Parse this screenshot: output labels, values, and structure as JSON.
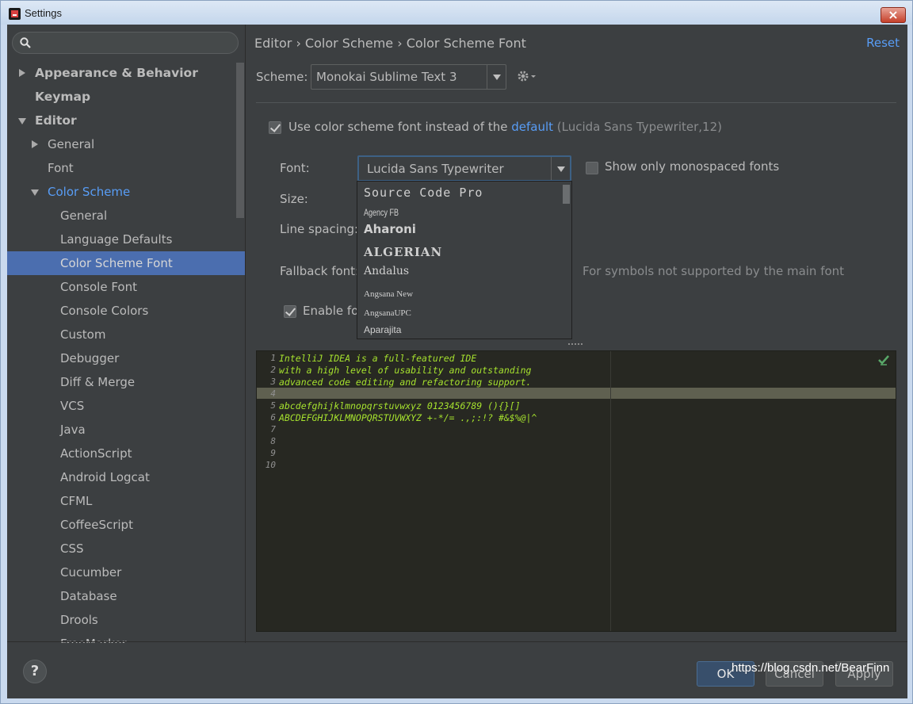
{
  "window": {
    "title": "Settings",
    "close_label": "×"
  },
  "search": {
    "placeholder": ""
  },
  "sidebar": {
    "items": [
      {
        "label": "Appearance & Behavior"
      },
      {
        "label": "Keymap"
      },
      {
        "label": "Editor"
      },
      {
        "label": "General"
      },
      {
        "label": "Font"
      },
      {
        "label": "Color Scheme"
      },
      {
        "label": "General"
      },
      {
        "label": "Language Defaults"
      },
      {
        "label": "Color Scheme Font"
      },
      {
        "label": "Console Font"
      },
      {
        "label": "Console Colors"
      },
      {
        "label": "Custom"
      },
      {
        "label": "Debugger"
      },
      {
        "label": "Diff & Merge"
      },
      {
        "label": "VCS"
      },
      {
        "label": "Java"
      },
      {
        "label": "ActionScript"
      },
      {
        "label": "Android Logcat"
      },
      {
        "label": "CFML"
      },
      {
        "label": "CoffeeScript"
      },
      {
        "label": "CSS"
      },
      {
        "label": "Cucumber"
      },
      {
        "label": "Database"
      },
      {
        "label": "Drools"
      },
      {
        "label": "FreeMarker"
      }
    ]
  },
  "header": {
    "breadcrumb": "Editor › Color Scheme › Color Scheme Font",
    "reset": "Reset"
  },
  "scheme": {
    "label": "Scheme:",
    "value": "Monokai Sublime Text 3"
  },
  "use_scheme_font": {
    "checked": true,
    "label_prefix": "Use color scheme font instead of the",
    "link": "default",
    "suffix": "(Lucida Sans Typewriter,12)"
  },
  "font": {
    "label": "Font:",
    "value": "Lucida Sans Typewriter",
    "mono_only_label": "Show only monospaced fonts",
    "mono_only_checked": false
  },
  "size": {
    "label": "Size:"
  },
  "line_spacing": {
    "label": "Line spacing:"
  },
  "fallback": {
    "label": "Fallback font:",
    "hint": "For symbols not supported by the main font"
  },
  "ligatures": {
    "label": "Enable for",
    "checked": true
  },
  "font_dropdown": {
    "options": [
      "Source Code Pro",
      "Agency FB",
      "Aharoni",
      "ALGERIAN",
      "Andalus",
      "Angsana New",
      "AngsanaUPC",
      "Aparajita"
    ]
  },
  "preview": {
    "lines": [
      {
        "num": "1",
        "text": "IntelliJ IDEA is a full-featured IDE"
      },
      {
        "num": "2",
        "text": "with a high level of usability and outstanding"
      },
      {
        "num": "3",
        "text": "advanced code editing and refactoring support."
      },
      {
        "num": "4",
        "text": ""
      },
      {
        "num": "5",
        "text": "abcdefghijklmnopqrstuvwxyz 0123456789 (){}[]"
      },
      {
        "num": "6",
        "text": "ABCDEFGHIJKLMNOPQRSTUVWXYZ +-*/= .,;:!? #&$%@|^"
      },
      {
        "num": "7",
        "text": ""
      },
      {
        "num": "8",
        "text": ""
      },
      {
        "num": "9",
        "text": ""
      },
      {
        "num": "10",
        "text": ""
      }
    ]
  },
  "buttons": {
    "help": "?",
    "ok": "OK",
    "cancel": "Cancel",
    "apply": "Apply"
  },
  "watermark": "https://blog.csdn.net/BearFinn",
  "colors": {
    "accent": "#589df6",
    "selection": "#4b6eaf",
    "code": "#a6e22e",
    "editor_bg": "#272822"
  }
}
